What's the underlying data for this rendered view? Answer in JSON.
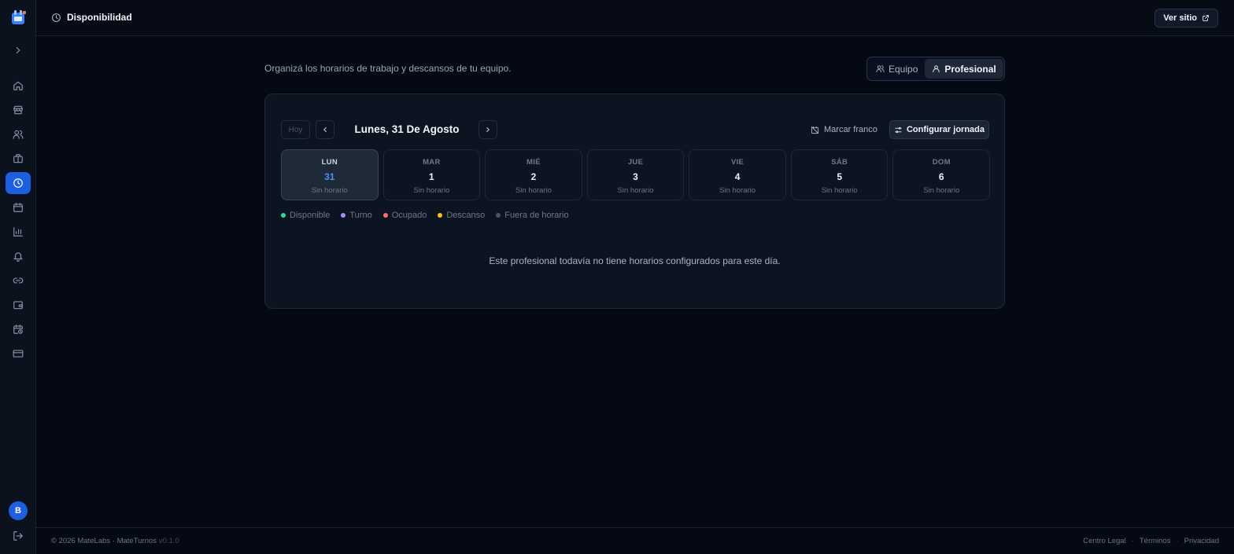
{
  "topbar": {
    "title": "Disponibilidad",
    "title_icon": "clock-icon",
    "view_site": "Ver sitio",
    "view_site_icon": "external-link-icon"
  },
  "sidebar": {
    "expand_icon": "chevron-right-icon",
    "items": [
      {
        "name": "home",
        "icon": "home-icon"
      },
      {
        "name": "store",
        "icon": "store-icon"
      },
      {
        "name": "users",
        "icon": "users-icon"
      },
      {
        "name": "services",
        "icon": "briefcase-icon"
      },
      {
        "name": "availability",
        "icon": "clock-icon",
        "active": true
      },
      {
        "name": "calendar",
        "icon": "calendar-icon"
      },
      {
        "name": "reports",
        "icon": "bar-chart-icon"
      },
      {
        "name": "notifications",
        "icon": "bell-icon"
      },
      {
        "name": "links",
        "icon": "link-icon"
      },
      {
        "name": "wallet",
        "icon": "wallet-icon"
      },
      {
        "name": "schedule",
        "icon": "calendar-clock-icon"
      },
      {
        "name": "billing",
        "icon": "credit-card-icon"
      }
    ],
    "avatar_initial": "B",
    "logout_icon": "logout-icon"
  },
  "main": {
    "subtitle": "Organizá los horarios de trabajo y descansos de tu equipo.",
    "view_toggle": {
      "team": "Equipo",
      "professional": "Profesional",
      "selected": "Profesional"
    }
  },
  "schedule": {
    "today_button": "Hoy",
    "current_date": "Lunes, 31 De Agosto",
    "mark_day_off": "Marcar franco",
    "configure_day": "Configurar jornada",
    "days": [
      {
        "name": "LUN",
        "number": "31",
        "status": "Sin horario",
        "selected": true
      },
      {
        "name": "MAR",
        "number": "1",
        "status": "Sin horario"
      },
      {
        "name": "MIÉ",
        "number": "2",
        "status": "Sin horario"
      },
      {
        "name": "JUE",
        "number": "3",
        "status": "Sin horario"
      },
      {
        "name": "VIE",
        "number": "4",
        "status": "Sin horario"
      },
      {
        "name": "SÁB",
        "number": "5",
        "status": "Sin horario"
      },
      {
        "name": "DOM",
        "number": "6",
        "status": "Sin horario"
      }
    ],
    "legend": [
      {
        "label": "Disponible",
        "color": "#34d399"
      },
      {
        "label": "Turno",
        "color": "#a78bfa"
      },
      {
        "label": "Ocupado",
        "color": "#f87171"
      },
      {
        "label": "Descanso",
        "color": "#fbbf24"
      },
      {
        "label": "Fuera de horario",
        "color": "#4b5563"
      }
    ],
    "empty_message": "Este profesional todavía no tiene horarios configurados para este día."
  },
  "footer": {
    "copyright": "© 2026 MateLabs · MateTurnos",
    "version": "v0.1.0",
    "links": [
      "Centro Legal",
      "Términos",
      "Privacidad"
    ]
  }
}
